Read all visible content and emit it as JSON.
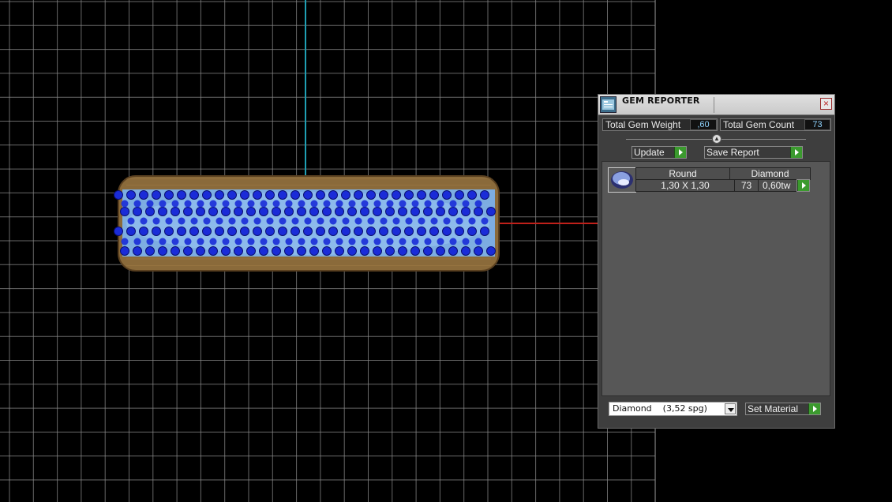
{
  "viewport": {
    "background": "#000000",
    "grid_color": "#8a8a8a",
    "axis_vertical_color": "#1fa0b4",
    "axis_horizontal_color": "#c0201a",
    "object": {
      "metal_color": "#8a6a3a",
      "gem_color": "#1a2cd8",
      "gem_highlight": "#7ab8ff"
    }
  },
  "panel": {
    "title": "GEM REPORTER",
    "total_gem_weight_label": "Total Gem Weight",
    "total_gem_weight_value": ",60",
    "total_gem_count_label": "Total Gem Count",
    "total_gem_count_value": "73",
    "update_label": "Update",
    "save_report_label": "Save Report",
    "table": {
      "header": {
        "shape": "Round",
        "material": "Diamond"
      },
      "rows": [
        {
          "size": "1,30 X 1,30",
          "count": "73",
          "weight": "0,60tw"
        }
      ]
    },
    "material_select": "Diamond    (3,52 spg)",
    "set_material_label": "Set Material",
    "colors": {
      "accent_value": "#8fd4ff",
      "go_button": "#3b9a2e"
    }
  }
}
